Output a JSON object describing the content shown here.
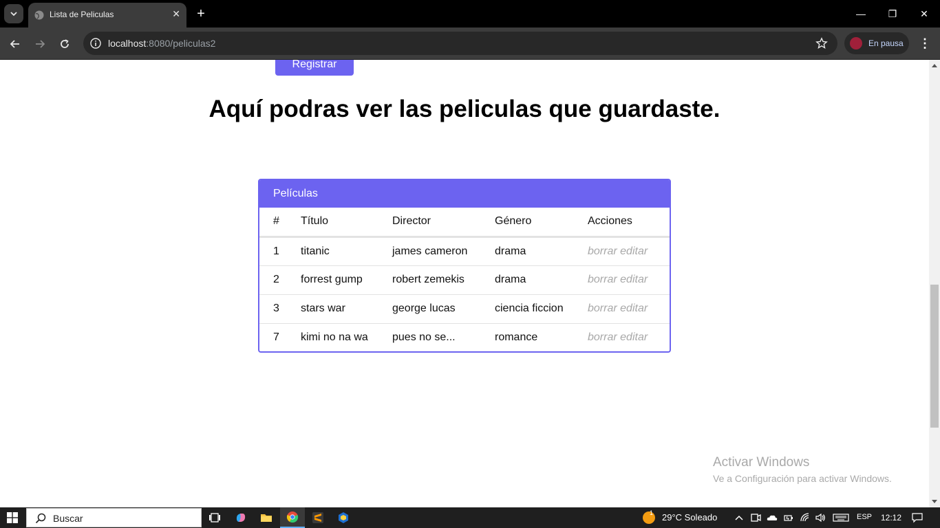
{
  "browser": {
    "tab_title": "Lista de Peliculas",
    "tab_close": "✕",
    "new_tab": "+",
    "url_host": "localhost",
    "url_path": ":8080/peliculas2",
    "profile_label": "En pausa",
    "menu": "⋮",
    "window_controls": [
      "—",
      "❐",
      "✕"
    ]
  },
  "page": {
    "register_label": "Registrar",
    "heading": "Aquí podras ver las peliculas que guardaste.",
    "card_title": "Películas",
    "columns": [
      "#",
      "Título",
      "Director",
      "Género",
      "Acciones"
    ],
    "rows": [
      {
        "num": "1",
        "title": "titanic",
        "director": "james cameron",
        "genre": "drama"
      },
      {
        "num": "2",
        "title": "forrest gump",
        "director": "robert zemekis",
        "genre": "drama"
      },
      {
        "num": "3",
        "title": "stars war",
        "director": "george lucas",
        "genre": "ciencia ficcion"
      },
      {
        "num": "7",
        "title": "kimi no na wa",
        "director": "pues no se...",
        "genre": "romance"
      }
    ],
    "delete_label": "borrar",
    "edit_label": "editar",
    "accent_color": "#6c63f0"
  },
  "watermark": {
    "line1": "Activar Windows",
    "line2": "Ve a Configuración para activar Windows."
  },
  "taskbar": {
    "search_placeholder": "Buscar",
    "weather_badge": "1",
    "weather": "29°C  Soleado",
    "language": "ESP",
    "time": "12:12"
  }
}
